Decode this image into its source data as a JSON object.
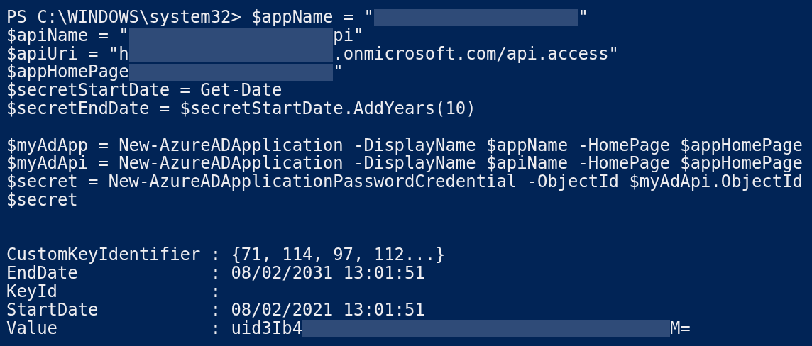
{
  "console": {
    "lines": [
      {
        "kind": "code",
        "segments": [
          {
            "kind": "text",
            "text": "PS C:\\WINDOWS\\system32> $appName = \""
          },
          {
            "kind": "redacted"
          },
          {
            "kind": "text",
            "text": "\""
          }
        ]
      },
      {
        "kind": "code",
        "segments": [
          {
            "kind": "text",
            "text": "$apiName = \""
          },
          {
            "kind": "redacted"
          },
          {
            "kind": "text",
            "text": "pi\""
          }
        ]
      },
      {
        "kind": "code",
        "segments": [
          {
            "kind": "text",
            "text": "$apiUri = \"h"
          },
          {
            "kind": "redacted"
          },
          {
            "kind": "text",
            "text": ".onmicrosoft.com/api.access\""
          }
        ]
      },
      {
        "kind": "code",
        "segments": [
          {
            "kind": "text",
            "text": "$appHomePage"
          },
          {
            "kind": "redacted"
          },
          {
            "kind": "text",
            "text": "\""
          }
        ]
      },
      {
        "kind": "code",
        "segments": [
          {
            "kind": "text",
            "text": "$secretStartDate = Get-Date"
          }
        ]
      },
      {
        "kind": "code",
        "segments": [
          {
            "kind": "text",
            "text": "$secretEndDate = $secretStartDate.AddYears(10)"
          }
        ]
      },
      {
        "kind": "blank"
      },
      {
        "kind": "code",
        "segments": [
          {
            "kind": "text",
            "text": "$myAdApp = New-AzureADApplication -DisplayName $appName -HomePage $appHomePage"
          }
        ]
      },
      {
        "kind": "code",
        "segments": [
          {
            "kind": "text",
            "text": "$myAdApi = New-AzureADApplication -DisplayName $apiName -HomePage $appHomePage"
          }
        ]
      },
      {
        "kind": "code",
        "segments": [
          {
            "kind": "text",
            "text": "$secret = New-AzureADApplicationPasswordCredential -ObjectId $myAdApi.ObjectId"
          }
        ]
      },
      {
        "kind": "code",
        "segments": [
          {
            "kind": "text",
            "text": "$secret"
          }
        ]
      },
      {
        "kind": "blank"
      },
      {
        "kind": "blank"
      }
    ],
    "output": [
      {
        "key": "CustomKeyIdentifier",
        "separator": ":",
        "segments": [
          {
            "kind": "text",
            "text": "{71, 114, 97, 112...}"
          }
        ]
      },
      {
        "key": "EndDate",
        "separator": ":",
        "segments": [
          {
            "kind": "text",
            "text": "08/02/2031 13:01:51"
          }
        ]
      },
      {
        "key": "KeyId",
        "separator": ":"
      },
      {
        "key": "StartDate",
        "separator": ":",
        "segments": [
          {
            "kind": "text",
            "text": "08/02/2021 13:01:51"
          }
        ]
      },
      {
        "key": "Value",
        "separator": ":",
        "segments": [
          {
            "kind": "text",
            "text": "uid3Ib4"
          },
          {
            "kind": "redacted"
          },
          {
            "kind": "text",
            "text": "M="
          }
        ]
      }
    ]
  }
}
